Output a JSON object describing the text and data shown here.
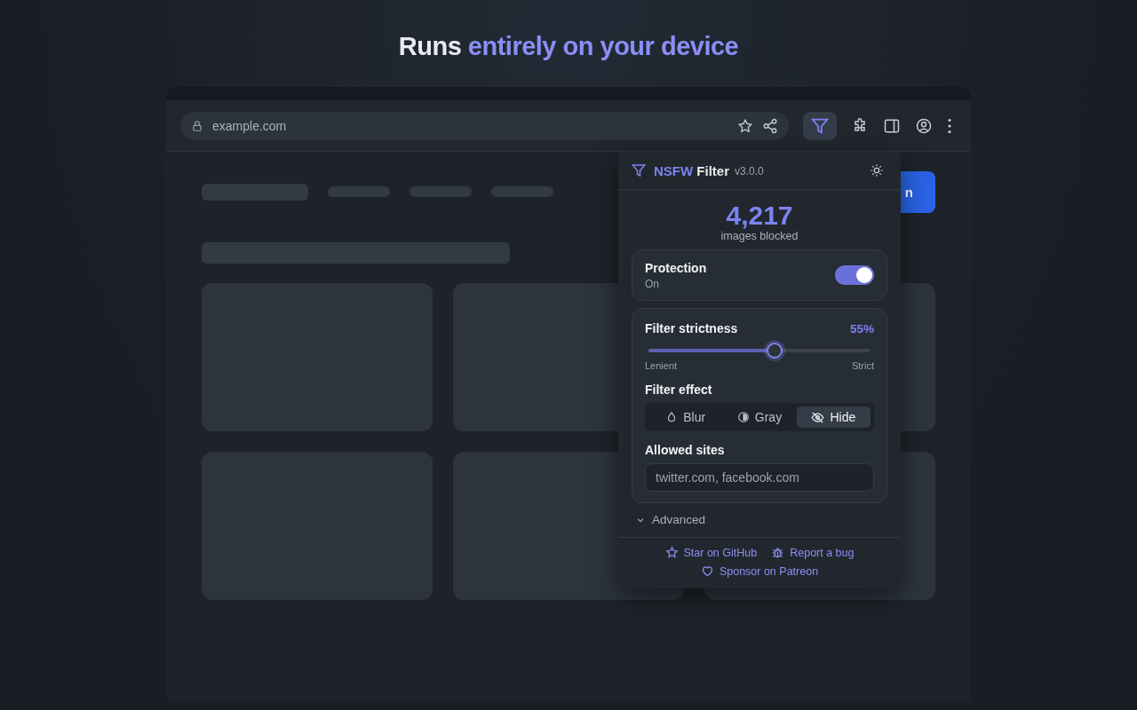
{
  "headline": {
    "text": "Runs",
    "highlight": "entirely on your device"
  },
  "browser": {
    "url": "example.com",
    "page_button": "n"
  },
  "popup": {
    "brand": "NSFW",
    "title": "Filter",
    "version": "v3.0.0",
    "count": "4,217",
    "count_label": "images blocked",
    "protection": {
      "label": "Protection",
      "status": "On",
      "on": true
    },
    "strictness": {
      "label": "Filter strictness",
      "reading": "55%",
      "level": 0.55,
      "min_label": "Lenient",
      "max_label": "Strict"
    },
    "effect": {
      "label": "Filter effect",
      "options": [
        {
          "kind": "blur",
          "label": "Blur",
          "selected": false
        },
        {
          "kind": "gray",
          "label": "Gray",
          "selected": false
        },
        {
          "kind": "hide",
          "label": "Hide",
          "selected": true
        }
      ]
    },
    "allowed": {
      "label": "Allowed sites",
      "placeholder": "twitter.com, facebook.com"
    },
    "advanced": {
      "label": "Advanced",
      "expanded": false
    },
    "links": [
      {
        "kind": "star",
        "label": "Star on GitHub"
      },
      {
        "kind": "bug",
        "label": "Report a bug"
      },
      {
        "kind": "heart",
        "label": "Sponsor on Patreon"
      }
    ]
  }
}
